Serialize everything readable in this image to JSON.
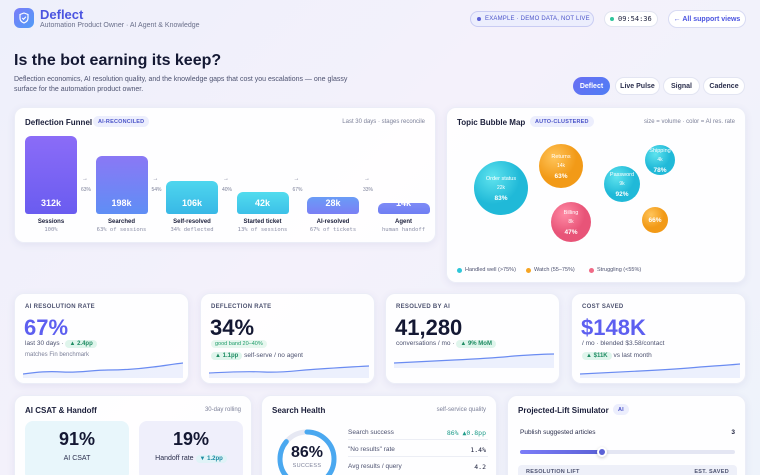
{
  "header": {
    "brand_title": "Deflect",
    "brand_subtitle": "Automation Product Owner · AI Agent & Knowledge",
    "demo_badge": "EXAMPLE · DEMO DATA, NOT LIVE",
    "clock": "09:54:36",
    "all_views_label": "← All support views"
  },
  "hero": {
    "title": "Is the bot earning its keep?",
    "description": "Deflection economics, AI resolution quality, and the knowledge gaps that cost you escalations — one glassy surface for the automation product owner."
  },
  "tabs": [
    {
      "label": "Deflect",
      "active": true
    },
    {
      "label": "Live Pulse",
      "active": false
    },
    {
      "label": "Signal",
      "active": false
    },
    {
      "label": "Cadence",
      "active": false
    }
  ],
  "funnel": {
    "title": "Deflection Funnel",
    "chip": "AI-RECONCILED",
    "note": "Last 30 days · stages reconcile",
    "stages": [
      {
        "value": "312k",
        "label": "Sessions",
        "sub": "100%",
        "fraction": 1.0,
        "color_top": "#8b6cf7",
        "color_bottom": "#6a5cf0"
      },
      {
        "value": "198k",
        "label": "Searched",
        "sub": "63% of sessions",
        "fraction": 0.75,
        "color_top": "#8a78f5",
        "color_bottom": "#5f8ef5"
      },
      {
        "value": "106k",
        "label": "Self-resolved",
        "sub": "34% deflected",
        "fraction": 0.42,
        "color_top": "#4ed6ee",
        "color_bottom": "#38b8e6"
      },
      {
        "value": "42k",
        "label": "Started ticket",
        "sub": "13% of sessions",
        "fraction": 0.28,
        "color_top": "#52dcee",
        "color_bottom": "#3cc0e8"
      },
      {
        "value": "28k",
        "label": "AI-resolved",
        "sub": "67% of tickets",
        "fraction": 0.22,
        "color_top": "#6a9cf6",
        "color_bottom": "#7a7ff5"
      },
      {
        "value": "14k",
        "label": "Agent",
        "sub": "human handoff",
        "fraction": 0.14,
        "color_top": "#7e8bf6",
        "color_bottom": "#6f7ef3"
      }
    ],
    "transitions": [
      "63%",
      "54%",
      "40%",
      "67%",
      "33%"
    ]
  },
  "bubble_map": {
    "title": "Topic Bubble Map",
    "chip": "AUTO-CLUSTERED",
    "note": "size = volume · color = AI res. rate",
    "bubbles": [
      {
        "topic": "Order status",
        "volume": "22k",
        "rate": "83%",
        "status": "good"
      },
      {
        "topic": "Returns",
        "volume": "14k",
        "rate": "63%",
        "status": "watch"
      },
      {
        "topic": "Password",
        "volume": "9k",
        "rate": "92%",
        "status": "good"
      },
      {
        "topic": "Shipping",
        "volume": "4k",
        "rate": "78%",
        "status": "good"
      },
      {
        "topic": "Billing",
        "volume": "8k",
        "rate": "47%",
        "status": "bad"
      },
      {
        "topic": "",
        "volume": "",
        "rate": "66%",
        "status": "watch"
      }
    ],
    "legend": [
      {
        "label": "Handled well (>75%)",
        "color": "#2ec6d8"
      },
      {
        "label": "Watch (55–75%)",
        "color": "#f5a524"
      },
      {
        "label": "Struggling (<55%)",
        "color": "#f06a86"
      }
    ]
  },
  "kpis": [
    {
      "label": "AI RESOLUTION RATE",
      "value": "67%",
      "sub": "last 30 days ·",
      "delta": "▲ 2.4pp",
      "sub2": "matches Fin benchmark",
      "color": "#5d5ff0"
    },
    {
      "label": "DEFLECTION RATE",
      "value": "34%",
      "band": "good band 20–40%",
      "delta": "▲ 1.1pp",
      "sub": "self-serve / no agent",
      "color": "#141833"
    },
    {
      "label": "RESOLVED BY AI",
      "value": "41,280",
      "sub": "conversations / mo ·",
      "delta": "▲ 9% MoM",
      "color": "#141833"
    },
    {
      "label": "COST SAVED",
      "value": "$148K",
      "sub": "/ mo · blended $3.58/contact",
      "delta": "▲ $11K",
      "sub2": "vs last month",
      "color": "#5d5ff0"
    }
  ],
  "csat": {
    "title": "AI CSAT & Handoff",
    "note": "30-day rolling",
    "tiles": [
      {
        "value": "91%",
        "label": "AI CSAT",
        "delta": ""
      },
      {
        "value": "19%",
        "label": "Handoff rate",
        "delta": "▼ 1.2pp"
      }
    ]
  },
  "search_health": {
    "title": "Search Health",
    "note": "self-service quality",
    "gauge_value": "86%",
    "gauge_label": "SUCCESS",
    "gauge_fraction": 0.86,
    "rows": [
      {
        "label": "Search success",
        "value": "86%",
        "delta": "▲0.8pp"
      },
      {
        "label": "\"No results\" rate",
        "value": "1.4%",
        "delta": ""
      },
      {
        "label": "Avg results / query",
        "value": "4.2",
        "delta": ""
      }
    ]
  },
  "simulator": {
    "title": "Projected-Lift Simulator",
    "chip": "AI",
    "slider_label": "Publish suggested articles",
    "slider_value": "3",
    "slider_fraction": 0.38,
    "col_left": "RESOLUTION LIFT",
    "col_right": "EST. SAVED"
  }
}
